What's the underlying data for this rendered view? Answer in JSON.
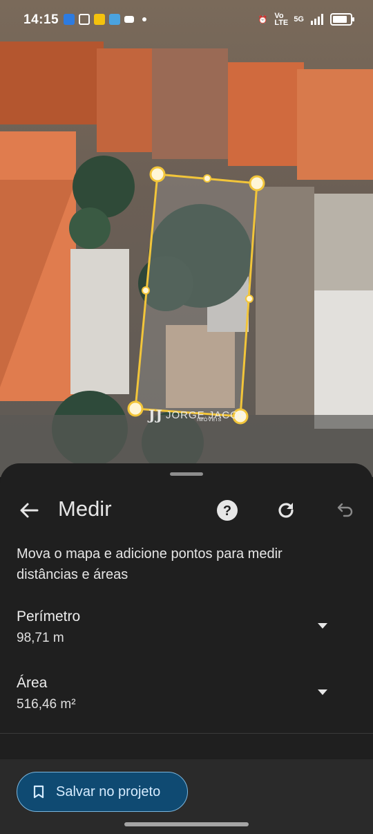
{
  "status_bar": {
    "time": "14:15",
    "network_label": "Vo LTE",
    "signal_label": "5G"
  },
  "map": {
    "watermark": "JORGE JACOB",
    "watermark_sub": "IMÓVEIS",
    "outline_color": "#f2c53a"
  },
  "sheet": {
    "title": "Medir",
    "description": "Mova o mapa e adicione pontos para medir distâncias e áreas",
    "perimeter_label": "Perímetro",
    "perimeter_value": "98,71 m",
    "area_label": "Área",
    "area_value": "516,46 m²",
    "save_label": "Salvar no projeto"
  },
  "icons": {
    "back": "arrow-left-icon",
    "help": "help-circle-icon",
    "refresh": "refresh-icon",
    "undo": "undo-icon",
    "expand": "chevron-down-icon",
    "bookmark": "bookmark-icon"
  }
}
